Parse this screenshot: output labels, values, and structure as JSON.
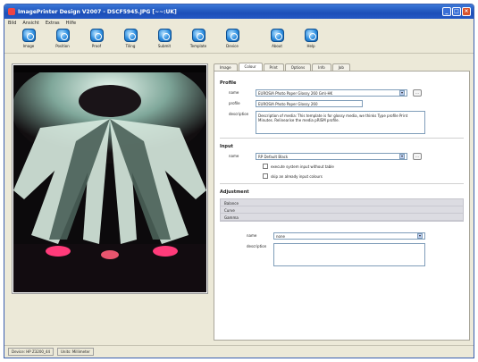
{
  "window": {
    "title": "ImagePrinter Design V2007 - DSCF5945.JPG [~~:UK]"
  },
  "menu": [
    "Bild",
    "Ansicht",
    "Extras",
    "Hilfe"
  ],
  "toolbar": [
    "Image",
    "Position",
    "Proof",
    "Tiling",
    "Submit",
    "Template",
    "Device",
    "About",
    "Help"
  ],
  "tabs": [
    "Image",
    "Colour",
    "Print",
    "Options",
    "Info",
    "Job"
  ],
  "active_tab": 1,
  "profile": {
    "section": "Profile",
    "name_label": "name",
    "name_value": "EUROSIA Photo Paper Glossy 260 Gm\\-HK",
    "profile_label": "profile",
    "profile_value": "EUROSIA Photo Paper Glossy 260",
    "desc_label": "description",
    "desc_value": "Description of media: This template is for glossy media, we thinks Type profile Print Minutes. Relinearise the media pRISM profile."
  },
  "input": {
    "section": "Input",
    "name_label": "name",
    "name_value": "RP Default Black",
    "check1": "execute system input without table",
    "check2": "skip an already input colours"
  },
  "adjustment": {
    "section": "Adjustment",
    "items": [
      "Balance",
      "Curve",
      "Gamma"
    ],
    "name_label": "name",
    "name_value": "none",
    "desc_label": "description"
  },
  "status": [
    "Device: HP Z3200_44",
    "Units: Millimeter"
  ],
  "colors": {
    "titlebar": "#1c4fb8",
    "accent": "#2d8ee0"
  }
}
